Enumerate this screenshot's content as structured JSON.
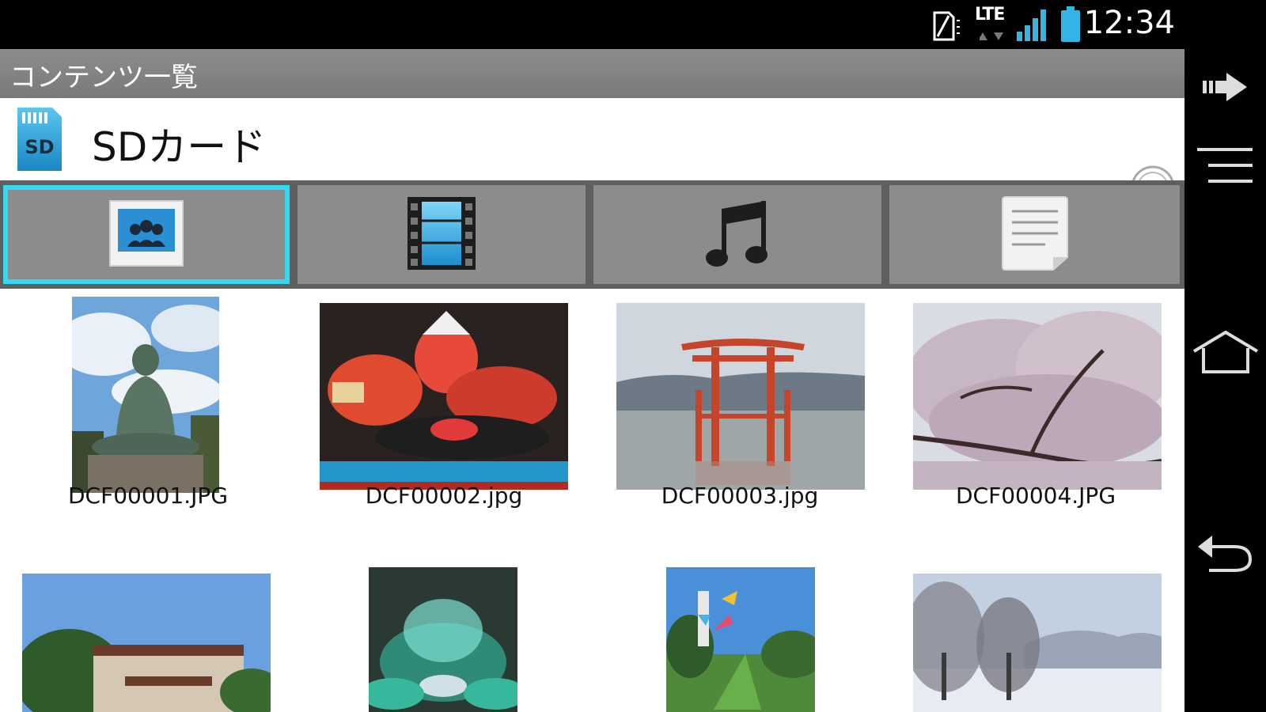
{
  "status_bar": {
    "network": "LTE",
    "time": "12:34"
  },
  "app": {
    "title": "コンテンツ一覧",
    "storage": {
      "label": "SDカード",
      "icon_text": "SD"
    },
    "tabs": [
      {
        "icon": "photo-icon",
        "selected": true
      },
      {
        "icon": "film-icon",
        "selected": false
      },
      {
        "icon": "music-note-icon",
        "selected": false
      },
      {
        "icon": "document-icon",
        "selected": false
      }
    ],
    "files": [
      {
        "name": "DCF00001.JPG"
      },
      {
        "name": "DCF00002.jpg"
      },
      {
        "name": "DCF00003.jpg"
      },
      {
        "name": "DCF00004.JPG"
      },
      {
        "name": ""
      },
      {
        "name": ""
      },
      {
        "name": ""
      },
      {
        "name": ""
      }
    ]
  },
  "nav": {
    "buttons": [
      "forward-icon",
      "menu-icon",
      "home-icon",
      "back-icon"
    ]
  },
  "colors": {
    "accent": "#35d7f3",
    "title_bar": "#808080",
    "tab_bg": "#8c8c8c"
  }
}
